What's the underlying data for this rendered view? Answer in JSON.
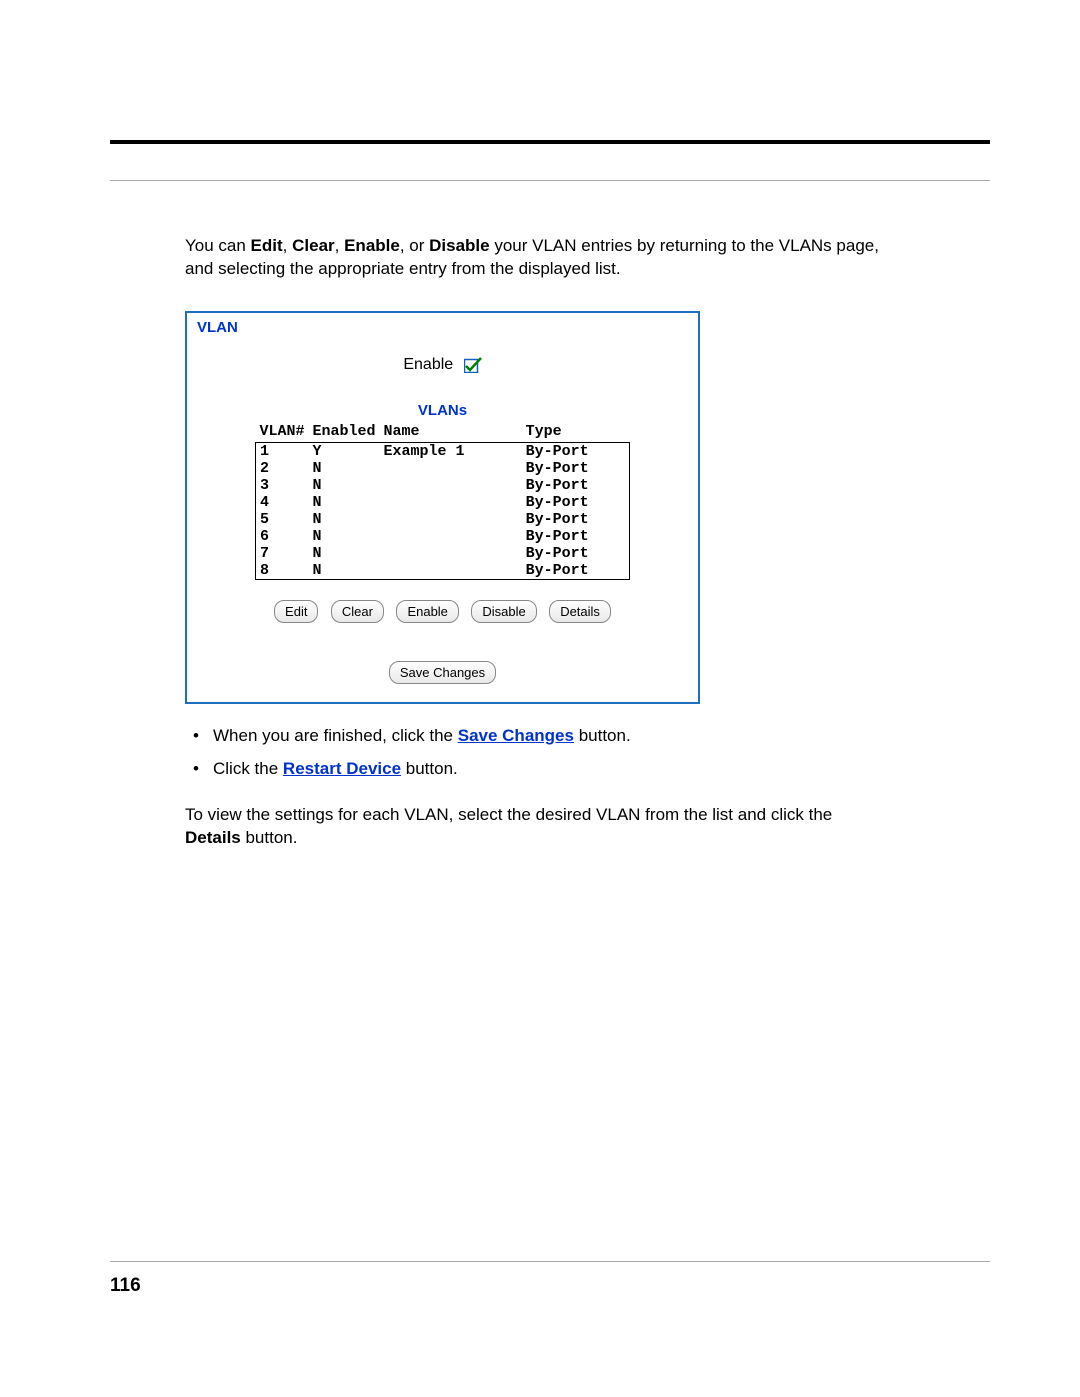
{
  "intro": {
    "prefix": "You can ",
    "b1": "Edit",
    "s1": ", ",
    "b2": "Clear",
    "s2": ", ",
    "b3": "Enable",
    "s3": ", or ",
    "b4": "Disable",
    "suffix": " your VLAN entries by returning to the VLANs page, and selecting the appropriate entry from the displayed list."
  },
  "panel": {
    "title": "VLAN",
    "enable_label": "Enable",
    "enable_checked": true,
    "subheading": "VLANs",
    "headers": {
      "vlan_num": "VLAN#",
      "enabled": "Enabled",
      "name": "Name",
      "type": "Type"
    },
    "rows": [
      {
        "num": "1",
        "enabled": "Y",
        "name": "Example 1",
        "type": "By-Port"
      },
      {
        "num": "2",
        "enabled": "N",
        "name": "",
        "type": "By-Port"
      },
      {
        "num": "3",
        "enabled": "N",
        "name": "",
        "type": "By-Port"
      },
      {
        "num": "4",
        "enabled": "N",
        "name": "",
        "type": "By-Port"
      },
      {
        "num": "5",
        "enabled": "N",
        "name": "",
        "type": "By-Port"
      },
      {
        "num": "6",
        "enabled": "N",
        "name": "",
        "type": "By-Port"
      },
      {
        "num": "7",
        "enabled": "N",
        "name": "",
        "type": "By-Port"
      },
      {
        "num": "8",
        "enabled": "N",
        "name": "",
        "type": "By-Port"
      }
    ],
    "buttons": {
      "edit": "Edit",
      "clear": "Clear",
      "enable": "Enable",
      "disable": "Disable",
      "details": "Details",
      "save": "Save Changes"
    }
  },
  "bullets": {
    "b1_pre": "When you are finished, click the ",
    "b1_link": "Save Changes",
    "b1_post": " button.",
    "b2_pre": "Click the ",
    "b2_link": "Restart Device",
    "b2_post": " button."
  },
  "para2": {
    "line1": "To view the settings for each VLAN, select the desired VLAN from the list and click the ",
    "bold": "Details",
    "line2": " button."
  },
  "page_number": "116"
}
